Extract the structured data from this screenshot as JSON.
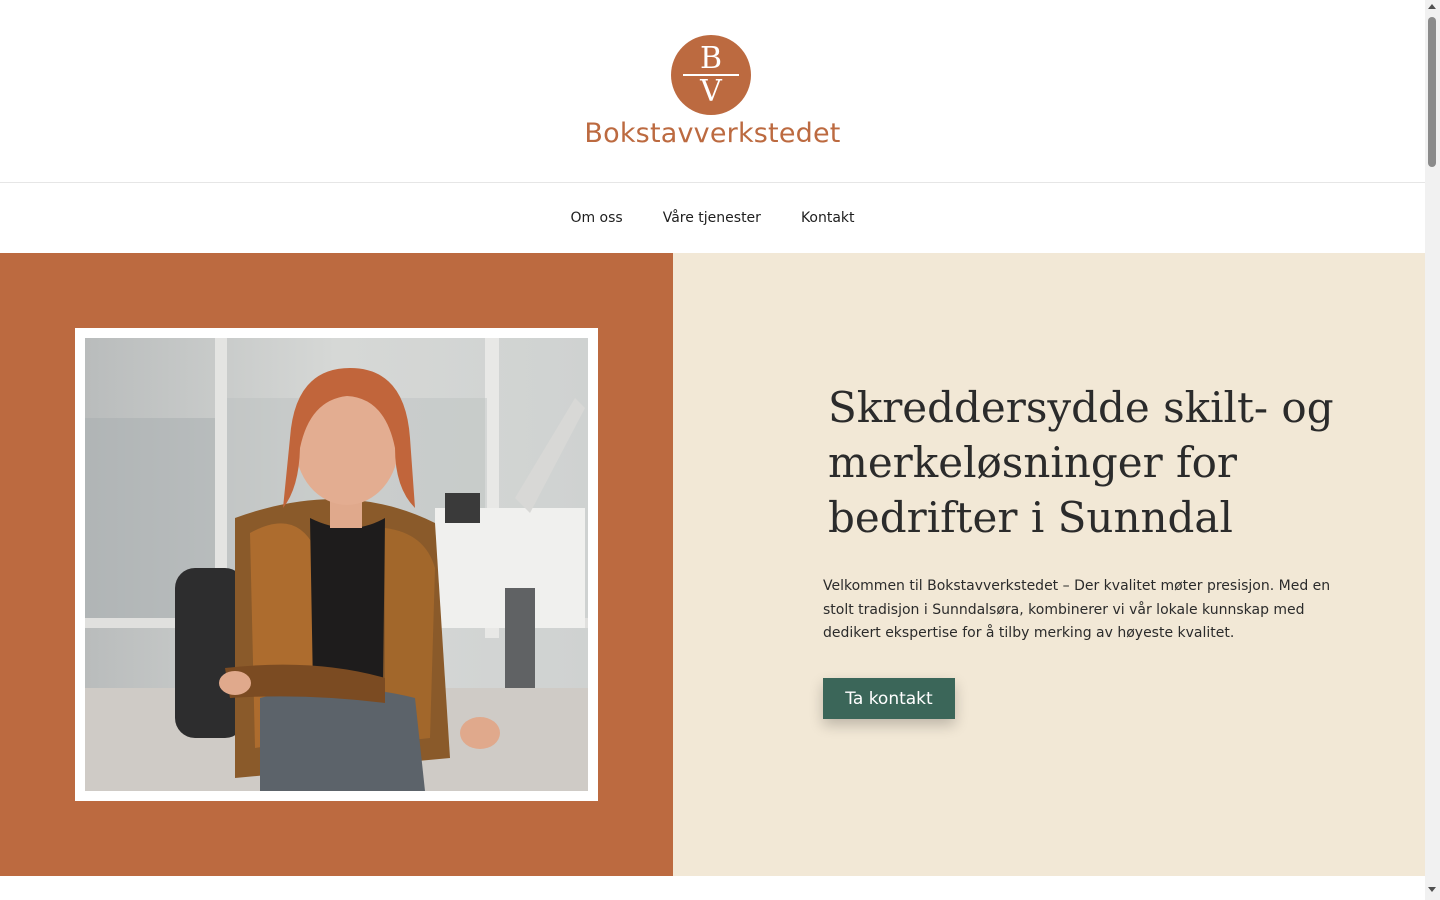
{
  "brand": {
    "name": "Bokstavverkstedet",
    "monogram_top": "B",
    "monogram_bottom": "V",
    "color": "#bc6a40"
  },
  "nav": {
    "items": [
      "Om oss",
      "Våre tjenester",
      "Kontakt"
    ]
  },
  "hero": {
    "title": "Skreddersydde skilt- og merkeløsninger for bedrifter i Sunndal",
    "text": "Velkommen til Bokstavverkstedet – Der kvalitet møter presisjon. Med en stolt tradisjon i Sunndalsøra, kombinerer vi vår lokale kunnskap med dedikert ekspertise for å tilby merking av høyeste kvalitet.",
    "cta_label": "Ta kontakt",
    "left_bg": "#bc6a40",
    "right_bg": "#f2e8d6",
    "cta_bg": "#3b6659"
  }
}
